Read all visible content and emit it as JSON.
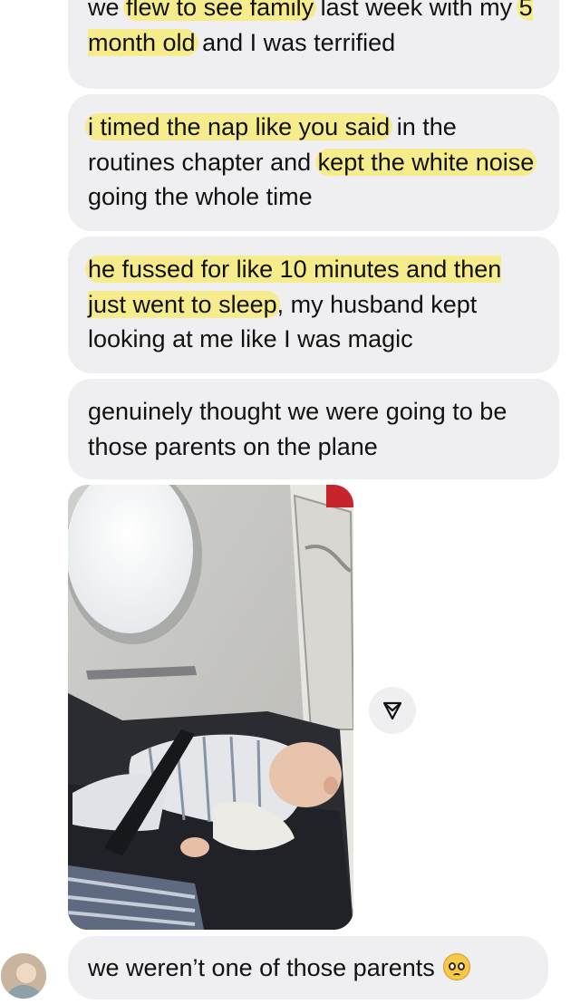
{
  "messages": [
    {
      "segments": [
        {
          "text": "we ",
          "hl": false
        },
        {
          "text": "flew to see family",
          "hl": true
        },
        {
          "text": " last week with my ",
          "hl": false
        },
        {
          "text": "5 month old",
          "hl": true
        },
        {
          "text": " and I was terrified",
          "hl": false
        }
      ]
    },
    {
      "segments": [
        {
          "text": "i timed the nap like you said",
          "hl": true
        },
        {
          "text": " in the routines chapter and ",
          "hl": false
        },
        {
          "text": "kept the white noise",
          "hl": true
        },
        {
          "text": " going the whole time",
          "hl": false
        }
      ]
    },
    {
      "segments": [
        {
          "text": "he fussed for like 10 minutes and then just went to sleep",
          "hl": true
        },
        {
          "text": ", my husband kept looking at me like I was magic",
          "hl": false
        }
      ]
    },
    {
      "segments": [
        {
          "text": "genuinely thought we were going to be those parents on the plane",
          "hl": false
        }
      ]
    }
  ],
  "last_message": {
    "text": "we weren’t one of those parents",
    "emoji": "pleading-face-emoji"
  },
  "photo": {
    "subject": "sleeping-baby-on-airplane-seat"
  },
  "icons": {
    "share": "send-arrow-icon"
  },
  "colors": {
    "bubble": "#efeff1",
    "highlight": "#f6ec8c"
  }
}
